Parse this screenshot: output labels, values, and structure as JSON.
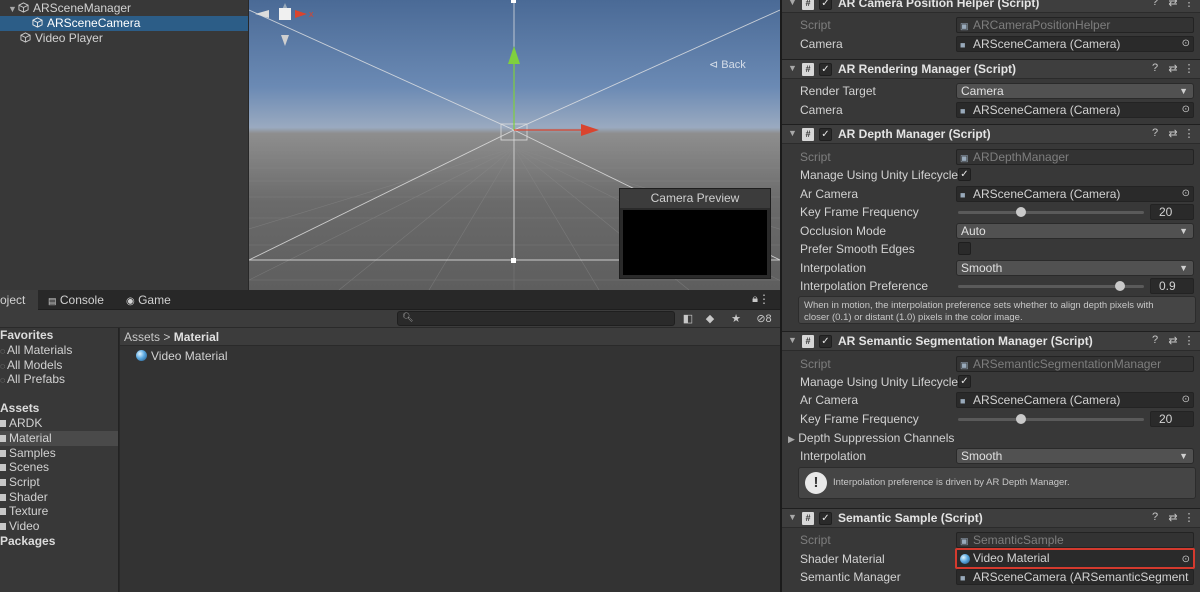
{
  "hierarchy": {
    "items": [
      {
        "label": "ARSceneManager"
      },
      {
        "label": "ARSceneCamera"
      },
      {
        "label": "Video Player"
      }
    ]
  },
  "scene": {
    "back_label": "Back",
    "camera_preview_title": "Camera Preview"
  },
  "bottom_tabs": {
    "project": "oject",
    "console": "Console",
    "game": "Game"
  },
  "toolbar": {
    "hidden_count": "8"
  },
  "project_tree": {
    "favorites_header": "Favorites",
    "favorites": [
      "All Materials",
      "All Models",
      "All Prefabs"
    ],
    "assets_header": "Assets",
    "assets": [
      "ARDK",
      "Material",
      "Samples",
      "Scenes",
      "Script",
      "Shader",
      "Texture",
      "Video"
    ],
    "packages_header": "Packages"
  },
  "project_content": {
    "breadcrumb_root": "Assets",
    "breadcrumb_sep": ">",
    "breadcrumb_current": "Material",
    "asset_name": "Video Material"
  },
  "inspector": {
    "c0": {
      "title": "AR Camera Position Helper (Script)",
      "script_label": "Script",
      "script_value": "ARCameraPositionHelper",
      "camera_label": "Camera",
      "camera_value": "ARSceneCamera (Camera)"
    },
    "c1": {
      "title": "AR Rendering Manager (Script)",
      "render_target_label": "Render Target",
      "render_target_value": "Camera",
      "camera_label": "Camera",
      "camera_value": "ARSceneCamera (Camera)"
    },
    "c2": {
      "title": "AR Depth Manager (Script)",
      "script_label": "Script",
      "script_value": "ARDepthManager",
      "lifecycle_label": "Manage Using Unity Lifecycle",
      "ar_camera_label": "Ar Camera",
      "ar_camera_value": "ARSceneCamera (Camera)",
      "kff_label": "Key Frame Frequency",
      "kff_value": "20",
      "kff_fraction": 0.34,
      "occlusion_label": "Occlusion Mode",
      "occlusion_value": "Auto",
      "smooth_edges_label": "Prefer Smooth Edges",
      "interp_label": "Interpolation",
      "interp_value": "Smooth",
      "interp_pref_label": "Interpolation Preference",
      "interp_pref_value": "0.9",
      "interp_pref_fraction": 0.87,
      "help_line1": "When in motion, the interpolation preference sets whether to align depth pixels with",
      "help_line2": "closer (0.1) or distant (1.0) pixels in the color image."
    },
    "c3": {
      "title": "AR Semantic Segmentation Manager (Script)",
      "script_label": "Script",
      "script_value": "ARSemanticSegmentationManager",
      "lifecycle_label": "Manage Using Unity Lifecycle",
      "ar_camera_label": "Ar Camera",
      "ar_camera_value": "ARSceneCamera (Camera)",
      "kff_label": "Key Frame Frequency",
      "kff_value": "20",
      "kff_fraction": 0.34,
      "suppression_label": "Depth Suppression Channels",
      "interp_label": "Interpolation",
      "interp_value": "Smooth",
      "warning": "Interpolation preference is driven by AR Depth Manager."
    },
    "c4": {
      "title": "Semantic Sample (Script)",
      "script_label": "Script",
      "script_value": "SemanticSample",
      "shader_label": "Shader Material",
      "shader_value": "Video Material",
      "manager_label": "Semantic Manager",
      "manager_value": "ARSceneCamera (ARSemanticSegment"
    }
  },
  "colors": {
    "selection": "#2c5d87",
    "highlight_border": "#d43a2e",
    "x_axis": "#d9442e",
    "y_axis": "#7fcf3e"
  }
}
